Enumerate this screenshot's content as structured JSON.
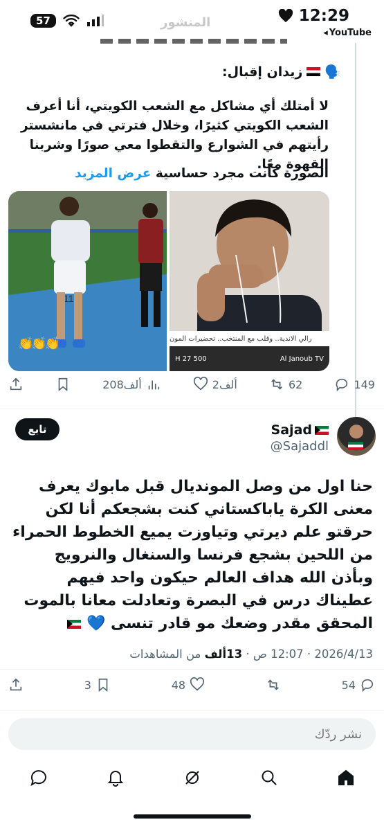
{
  "status_bar": {
    "battery": "57",
    "ghost_title": "المنشور",
    "time": "12:29",
    "back_app": "YouTube"
  },
  "quoted_post": {
    "author": "زيدان إقبال:",
    "body": "لا أمتلك أي مشاكل مع الشعب الكويتي، أنا أعرف الشعب الكويتي كثيرًا، وخلال فترتي في مانشستر رأيتهم في الشوارع والتقطوا معي صورًا وشربنا القهوة معًا.",
    "caption": "الصورة كانت مجرد حساسية",
    "show_more": "عرض المزيد",
    "news_strip": "رالي الاندية.. وقلب مع المنتخب.. تحضيرات المون",
    "news_bar_left": "H 27 500",
    "news_bar_right": "Al Janoub TV",
    "actions": {
      "replies": "149",
      "reposts": "62",
      "likes": "2ألف",
      "views": "208ألف"
    }
  },
  "post": {
    "author_name": "Sajad",
    "handle": "@Sajaddl",
    "follow_label": "تابع",
    "text": "حنا اول من وصل المونديال قبل مابوك يعرف معنى الكرة ياباكستاني كنت بشجعكم أنا لكن حرقتو علم ديرتي وتياوزت يميع الخطوط الحمراء من اللحين بشجع فرنسا والسنغال والنرويج وبأذن الله هداف العالم حيكون واحد فيهم\nعطيناك درس في البصرة وتعادلت معانا بالموت المحقق مقدر وضعك مو قادر تنسى 💙",
    "date": "2026/4/13",
    "time": "12:07 ص",
    "views_count": "13ألف",
    "views_label": "من المشاهدات",
    "actions": {
      "replies": "54",
      "reposts": "",
      "likes": "48",
      "bookmarks": "3"
    }
  },
  "reply_placeholder": "نشر ردّك"
}
